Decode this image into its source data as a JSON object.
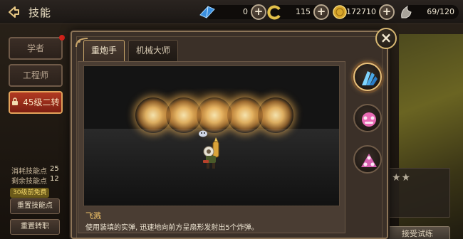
{
  "header": {
    "title": "技能",
    "resources": [
      {
        "icon": "blue-crystal-icon",
        "value": "0"
      },
      {
        "icon": "gold-swirl-icon",
        "value": "115"
      },
      {
        "icon": "gold-coin-icon",
        "value": "172710"
      },
      {
        "icon": "stamina-icon",
        "value": "69/120"
      }
    ]
  },
  "sidebar": {
    "items": [
      {
        "label": "学者"
      },
      {
        "label": "工程师"
      },
      {
        "label": "45级二转"
      }
    ],
    "stats": [
      {
        "label": "消耗技能点",
        "value": "25"
      },
      {
        "label": "剩余技能点",
        "value": "12"
      }
    ],
    "free_badge": "30级前免费",
    "reset_skill_points": "重置技能点",
    "reset_job_change": "重置转职"
  },
  "modal": {
    "tabs": [
      {
        "label": "重炮手"
      },
      {
        "label": "机械大师"
      }
    ],
    "skill": {
      "name": "飞溅",
      "description": "使用装填的实弹, 迅速地向前方呈扇形发射出5个炸弹。"
    }
  },
  "right_panel": {
    "accept_label": "接受试练",
    "stars": "★★"
  },
  "colors": {
    "active_tab_border": "#c8a56a",
    "active_sidebar": "#b13a22",
    "skill_name": "#f5c66a"
  }
}
